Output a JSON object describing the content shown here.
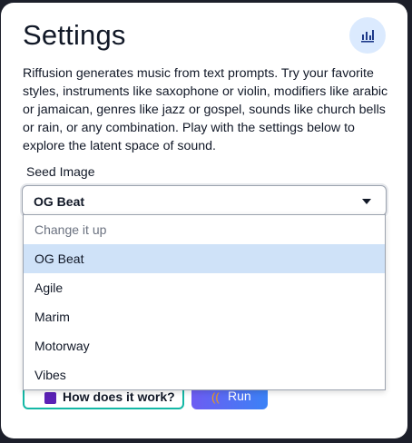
{
  "modal": {
    "title": "Settings",
    "stats_icon": "bar-chart-icon",
    "description": "Riffusion generates music from text prompts. Try your favorite styles, instruments like saxophone or violin, modifiers like arabic or jamaican, genres like jazz or gospel, sounds like church bells or rain, or any combination. Play with the settings below to explore the latent space of sound.",
    "seed_image": {
      "label": "Seed Image",
      "selected": "OG Beat",
      "options": [
        {
          "label": "Change it up",
          "placeholder": true
        },
        {
          "label": "OG Beat",
          "selected": true
        },
        {
          "label": "Agile"
        },
        {
          "label": "Marim"
        },
        {
          "label": "Motorway"
        },
        {
          "label": "Vibes"
        }
      ]
    },
    "buttons": {
      "how_label": "How does it work?",
      "run_label": "Run"
    }
  },
  "colors": {
    "accent_bg": "#dbeafe",
    "selected_option": "#cfe2f8",
    "teal_border": "#14b8a6"
  }
}
